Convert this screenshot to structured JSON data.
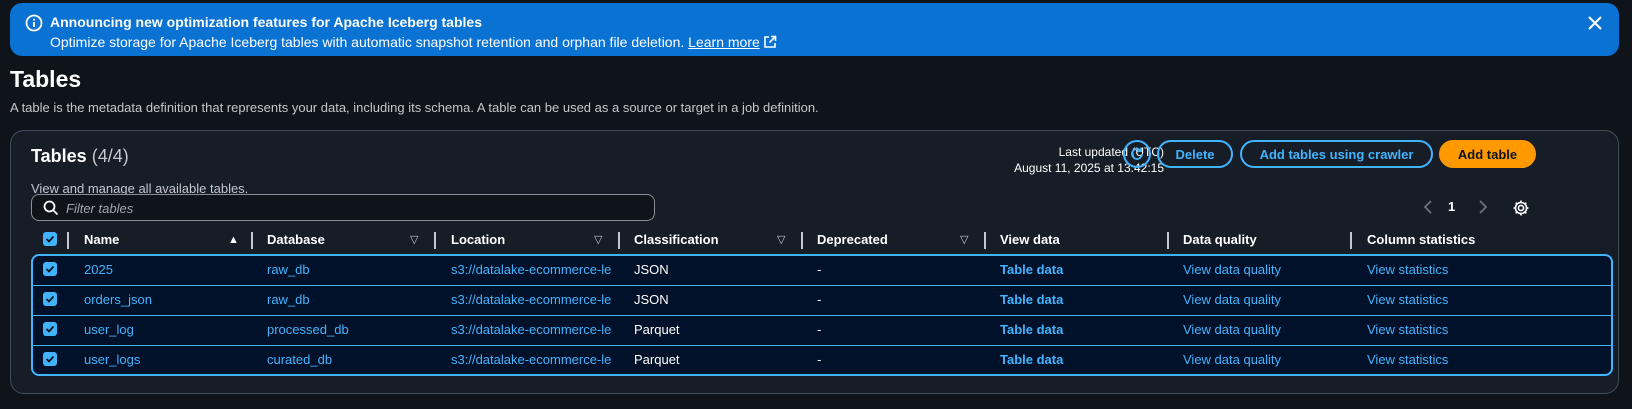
{
  "banner": {
    "title": "Announcing new optimization features for Apache Iceberg tables",
    "description": "Optimize storage for Apache Iceberg tables with automatic snapshot retention and orphan file deletion.",
    "link_label": "Learn more",
    "color": "#0972d3"
  },
  "page": {
    "title": "Tables",
    "description": "A table is the metadata definition that represents your data, including its schema. A table can be used as a source or target in a job definition."
  },
  "container": {
    "title": "Tables",
    "count": "(4/4)",
    "description": "View and manage all available tables.",
    "last_updated_label": "Last updated (UTC)",
    "last_updated_value": "August 11, 2025 at 13:42:15",
    "buttons": {
      "delete": "Delete",
      "add_crawler": "Add tables using crawler",
      "add_table": "Add table"
    },
    "filter_placeholder": "Filter tables",
    "pagination": {
      "current_page": "1"
    }
  },
  "table": {
    "columns": [
      "Name",
      "Database",
      "Location",
      "Classification",
      "Deprecated",
      "View data",
      "Data quality",
      "Column statistics"
    ],
    "rows": [
      {
        "name": "2025",
        "database": "raw_db",
        "location": "s3://datalake-ecommerce-le",
        "classification": "JSON",
        "deprecated": "-",
        "view_data": "Table data",
        "data_quality": "View data quality",
        "column_statistics": "View statistics",
        "selected": true
      },
      {
        "name": "orders_json",
        "database": "raw_db",
        "location": "s3://datalake-ecommerce-le",
        "classification": "JSON",
        "deprecated": "-",
        "view_data": "Table data",
        "data_quality": "View data quality",
        "column_statistics": "View statistics",
        "selected": true
      },
      {
        "name": "user_log",
        "database": "processed_db",
        "location": "s3://datalake-ecommerce-le",
        "classification": "Parquet",
        "deprecated": "-",
        "view_data": "Table data",
        "data_quality": "View data quality",
        "column_statistics": "View statistics",
        "selected": true
      },
      {
        "name": "user_logs",
        "database": "curated_db",
        "location": "s3://datalake-ecommerce-le",
        "classification": "Parquet",
        "deprecated": "-",
        "view_data": "Table data",
        "data_quality": "View data quality",
        "column_statistics": "View statistics",
        "selected": true
      }
    ]
  },
  "icons": {
    "banner": "info-icon",
    "dismiss": "close-icon",
    "external": "external-link-icon",
    "refresh": "refresh-icon",
    "search": "search-icon",
    "settings": "gear-icon"
  },
  "colors": {
    "background": "#0f141a",
    "panel": "#161d26",
    "accent": "#42b4ff",
    "primary_button": "#ff9900",
    "selected_row": "#001129"
  }
}
